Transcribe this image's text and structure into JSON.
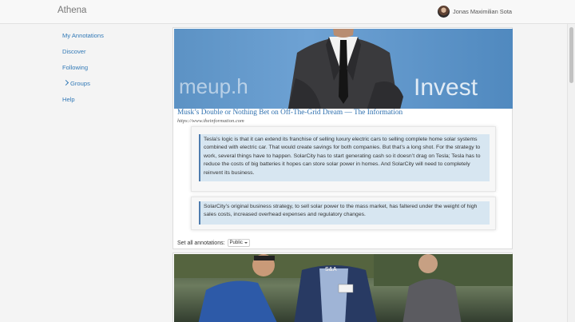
{
  "app": {
    "name": "Athena"
  },
  "user": {
    "name": "Jonas Maximilian Sota"
  },
  "sidebar": {
    "items": [
      {
        "label": "My Annotations"
      },
      {
        "label": "Discover"
      },
      {
        "label": "Following"
      },
      {
        "label": "Groups"
      },
      {
        "label": "Help"
      }
    ]
  },
  "article": {
    "title": "Musk’s Double or Nothing Bet on Off-The-Grid Dream — The Information",
    "url": "https://www.theinformation.com",
    "image_text": [
      "meup.h",
      "Invest"
    ]
  },
  "annotations": [
    {
      "text": "Tesla’s logic is that it can extend its franchise of selling luxury electric cars to selling complete home solar systems combined with electric car. That would create savings for both companies. But that’s a long shot. For the strategy to work, several things have to happen. SolarCity has to start generating cash so it doesn’t drag on Tesla; Tesla has to reduce the costs of big batteries it hopes can store solar power in homes. And  SolarCity will need to completely reinvent its business."
    },
    {
      "text": "SolarCity’s original business strategy, to sell solar power to the mass market, has faltered under the weight of high sales costs, increased overhead expenses and regulatory changes."
    }
  ],
  "set_all": {
    "label": "Set all annotations:",
    "value": "Public"
  },
  "second_card": {
    "badge_text": "S&A"
  },
  "colors": {
    "link": "#337ab7",
    "quote_bg": "#d7e6f1",
    "quote_border": "#4f7cae"
  }
}
